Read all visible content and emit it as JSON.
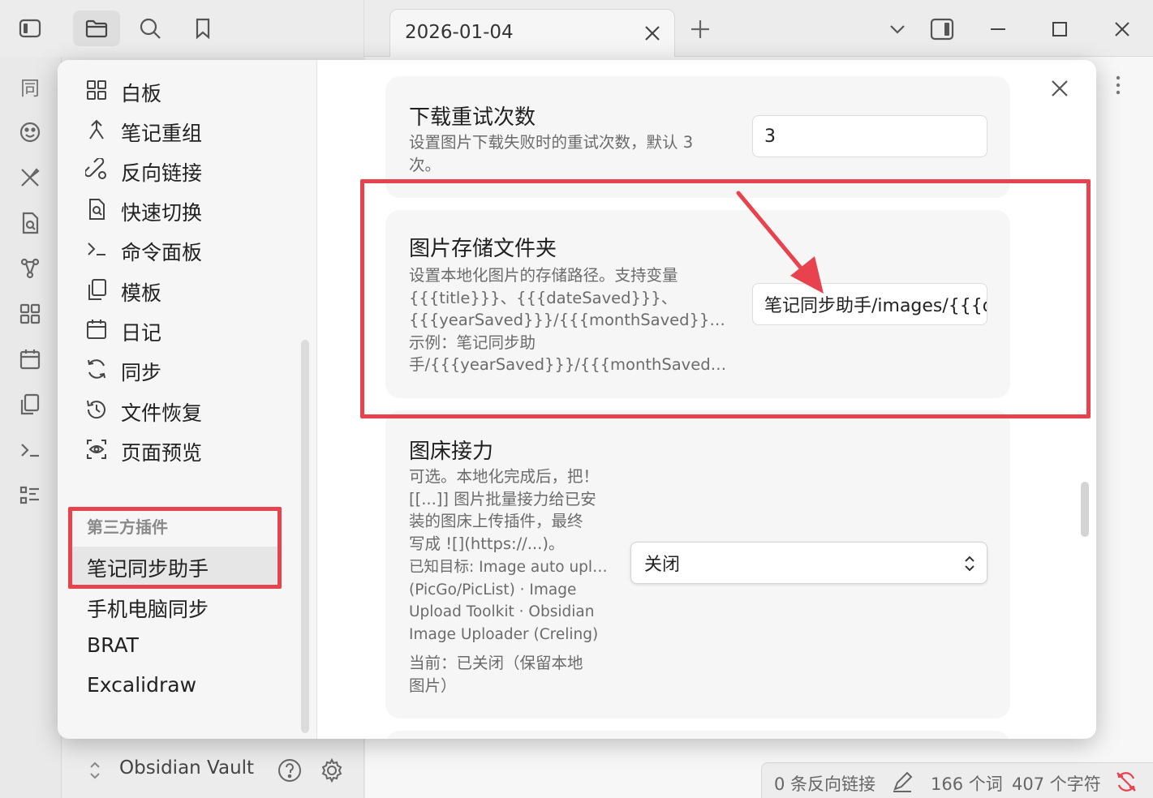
{
  "titlebar": {
    "tab_title": "2026-01-04",
    "icons": [
      "sidebar-toggle-icon",
      "folder-icon",
      "search-icon",
      "bookmark-icon"
    ],
    "window_controls": [
      "chevron-down-icon",
      "right-sidebar-icon",
      "minimize-icon",
      "maximize-icon",
      "close-icon"
    ]
  },
  "ribbon": {
    "icons": [
      "sync-tag-icon",
      "smiley-icon",
      "brush-icon",
      "file-search-icon",
      "graph-icon",
      "canvas-icon",
      "calendar-icon",
      "copy-icon",
      "terminal-icon",
      "list-icon"
    ],
    "first_glyph": "同"
  },
  "explorer": {
    "vault_name": "Obsidian Vault"
  },
  "statusbar": {
    "backlinks": "0 条反向链接",
    "words": "166 个词",
    "chars": "407 个字符"
  },
  "settings": {
    "core_plugins": [
      {
        "label": "白板",
        "icon": "canvas-icon"
      },
      {
        "label": "笔记重组",
        "icon": "merge-icon"
      },
      {
        "label": "反向链接",
        "icon": "backlink-icon"
      },
      {
        "label": "快速切换",
        "icon": "quick-switch-icon"
      },
      {
        "label": "命令面板",
        "icon": "terminal-icon"
      },
      {
        "label": "模板",
        "icon": "template-icon"
      },
      {
        "label": "日记",
        "icon": "calendar-icon"
      },
      {
        "label": "同步",
        "icon": "sync-icon"
      },
      {
        "label": "文件恢复",
        "icon": "history-icon"
      },
      {
        "label": "页面预览",
        "icon": "preview-icon"
      }
    ],
    "third_party_heading": "第三方插件",
    "third_party": [
      {
        "label": "笔记同步助手",
        "active": true
      },
      {
        "label": "手机电脑同步",
        "active": false
      },
      {
        "label": "BRAT",
        "active": false
      },
      {
        "label": "Excalidraw",
        "active": false
      }
    ],
    "retry": {
      "title": "下载重试次数",
      "desc_lines": [
        "设置图片下载失败时的重试次数，默认 3",
        "次。"
      ],
      "value": "3"
    },
    "folder": {
      "title": "图片存储文件夹",
      "desc_lines": [
        "设置本地化图片的存储路径。支持变量",
        "{{{title}}}、{{{dateSaved}}}、",
        "{{{yearSaved}}}/{{{monthSaved}}}/{{{da...",
        "示例：笔记同步助",
        "手/{{{yearSaved}}}/{{{monthSaved}}}/i..."
      ],
      "value": "笔记同步助手/images/{{{d"
    },
    "relay": {
      "title": "图床接力",
      "desc_lines": [
        "可选。本地化完成后，把！",
        "[[...]] 图片批量接力给已安",
        "装的图床上传插件，最终",
        "写成 ![](https://...)。"
      ],
      "targets_lines": [
        "已知目标: Image auto upload",
        "(PicGo/PicList) · Image",
        "Upload Toolkit · Obsidian",
        "Image Uploader (Creling)"
      ],
      "current_lines": [
        "当前：已关闭（保留本地",
        "图片）"
      ],
      "select_value": "关闭"
    }
  },
  "annotation_color": "#e8424f"
}
